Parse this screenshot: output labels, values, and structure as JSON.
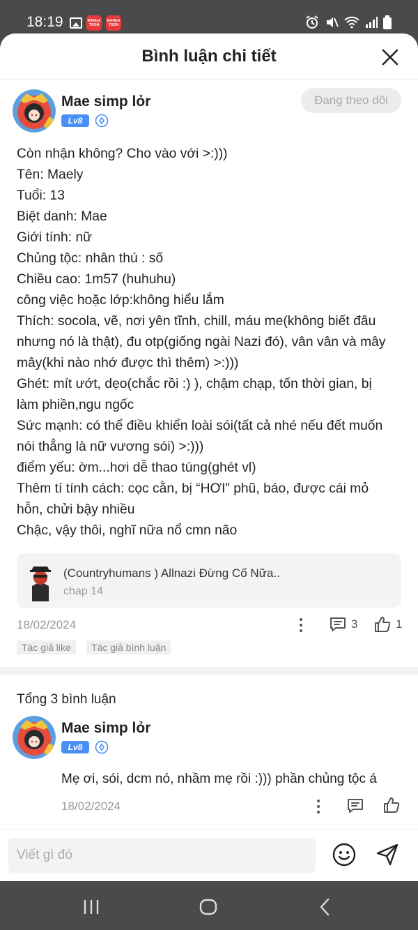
{
  "status_bar": {
    "time": "18:19",
    "app_badge_1": "MANGA TOON",
    "app_badge_2": "MANGA TOON"
  },
  "header": {
    "title": "Bình luận chi tiết"
  },
  "comment": {
    "user_name": "Mae simp lỏr",
    "level": "Lv8",
    "follow_label": "Đang theo dõi",
    "lines": [
      "Còn nhận không? Cho vào với >:)))",
      "Tên: Maely",
      "Tuổi: 13",
      "Biệt danh: Mae",
      "Giới tính: nữ",
      "Chủng tộc: nhân thú : số",
      "Chiều cao: 1m57 (huhuhu)",
      "công việc hoặc lớp:không hiểu lắm",
      "Thích: socola, vẽ, nơi yên tĩnh, chill, máu me(không biết đâu",
      "nhưng nó là thật), đu otp(giống ngài Nazi đó), vân vân và mây",
      "mây(khi nào nhớ được thì thêm) >:)))",
      "Ghét: mít ướt, dẹo(chắc rồi :) ), chậm chạp, tốn thời gian, bị",
      "làm phiền,ngu ngốc",
      "Sức mạnh: có thể điều khiển loài sói(tất cả nhé nếu đết muốn",
      "nói thẳng là nữ vương sói) >:)))",
      "điểm yếu: ờm...hơi dễ thao túng(ghét vl)",
      "Thêm tí tính cách: cọc cằn, bị “HƠI” phũ, báo, được cái mỏ",
      "hỗn, chửi bậy nhiều",
      "Chậc, vậy thôi, nghĩ nữa nổ cmn não"
    ],
    "manga": {
      "title": "(Countryhumans ) Allnazi Đừng Cố Nữa..",
      "chapter": "chap 14"
    },
    "date": "18/02/2024",
    "reply_count": "3",
    "like_count": "1",
    "tags": [
      "Tác giả like",
      "Tác giả bình luận"
    ]
  },
  "replies": {
    "total_label": "Tổng 3 bình luận",
    "items": [
      {
        "user_name": "Mae simp lỏr",
        "level": "Lv8",
        "text": "Mẹ ơi, sói, dcm nó, nhầm mẹ rồi :))) phần chủng tộc á",
        "date": "18/02/2024"
      }
    ]
  },
  "input": {
    "placeholder": "Viết gì đó"
  },
  "colors": {
    "accent": "#4a8ff3",
    "status_bar_bg": "#4a4a4a",
    "app_badge": "#e8393b"
  },
  "icons": [
    "close-icon",
    "verified-icon",
    "more-icon",
    "reply-icon",
    "like-icon",
    "emoji-icon",
    "send-icon",
    "recents-icon",
    "home-icon",
    "back-icon"
  ]
}
